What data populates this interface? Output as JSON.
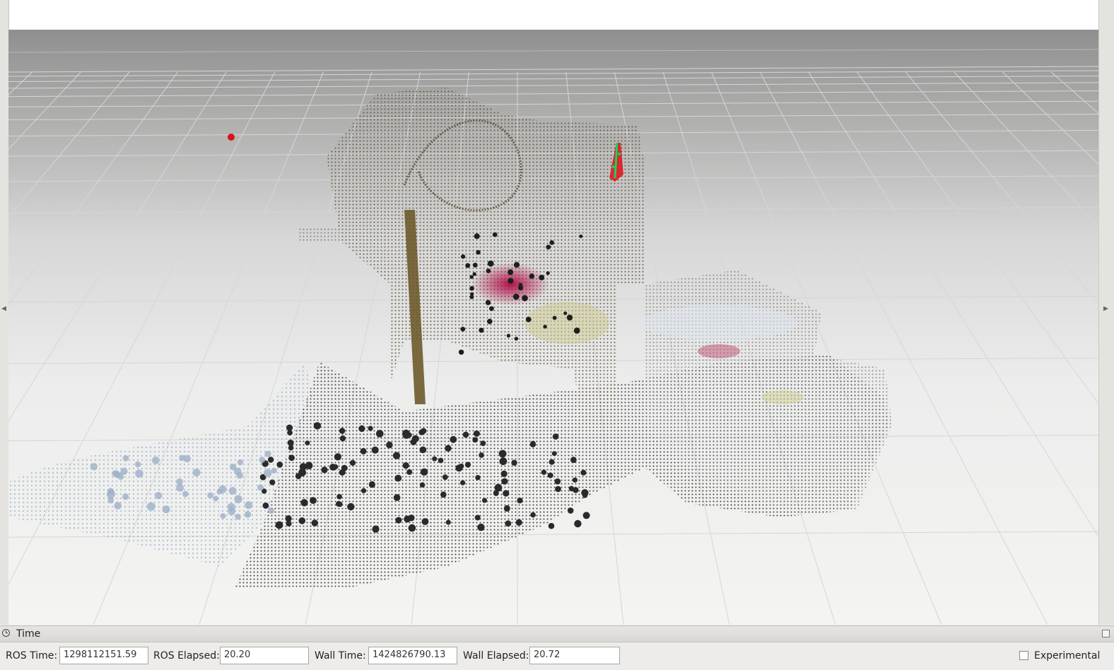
{
  "time_panel": {
    "title": "Time",
    "ros_time_label": "ROS Time:",
    "ros_time_value": "1298112151.59",
    "ros_elapsed_label": "ROS Elapsed:",
    "ros_elapsed_value": "20.20",
    "wall_time_label": "Wall Time:",
    "wall_time_value": "1424826790.13",
    "wall_elapsed_label": "Wall Elapsed:",
    "wall_elapsed_value": "20.72",
    "experimental_label": "Experimental",
    "experimental_checked": false
  },
  "icons": [
    "clock-icon",
    "collapse-left-icon",
    "collapse-right-icon",
    "float-panel-icon"
  ],
  "colors": {
    "background_top": "#8f8f8f",
    "background_bottom": "#f4f4f2",
    "marker_red": "#e0101a",
    "marker_green": "#1cd15a",
    "panel": "#edecea"
  }
}
